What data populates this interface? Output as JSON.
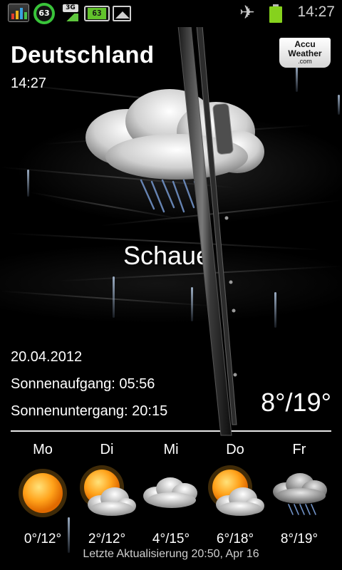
{
  "status_bar": {
    "icons": [
      "chart-icon",
      "battery-percent-ring-icon",
      "3g-signal-icon",
      "battery-widget-icon",
      "picture-icon",
      "airplane-mode-icon",
      "battery-icon"
    ],
    "ring_value": "63",
    "network_label": "3G",
    "battery_widget_value": "63",
    "time": "14:27",
    "accent_green": "#62c22c"
  },
  "header": {
    "location": "Deutschland",
    "local_time": "14:27",
    "provider_logo": {
      "line1": "Accu",
      "line2": "Weather",
      "line3": ".com"
    }
  },
  "current": {
    "icon": "rain-cloud-icon",
    "condition": "Schauer",
    "date": "20.04.2012",
    "sunrise": "Sonnenaufgang: 05:56",
    "sunset": "Sonnenuntergang: 20:15",
    "temp_range": "8°/19°"
  },
  "forecast": [
    {
      "day": "Mo",
      "icon": "sun-icon",
      "temp": "0°/12°"
    },
    {
      "day": "Di",
      "icon": "sun-behind-cloud-icon",
      "temp": "2°/12°"
    },
    {
      "day": "Mi",
      "icon": "cloud-icon",
      "temp": "4°/15°"
    },
    {
      "day": "Do",
      "icon": "sun-behind-cloud-icon",
      "temp": "6°/18°"
    },
    {
      "day": "Fr",
      "icon": "rain-cloud-icon",
      "temp": "8°/19°"
    }
  ],
  "footer": {
    "last_updated": "Letzte Aktualisierung 20:50, Apr 16"
  }
}
